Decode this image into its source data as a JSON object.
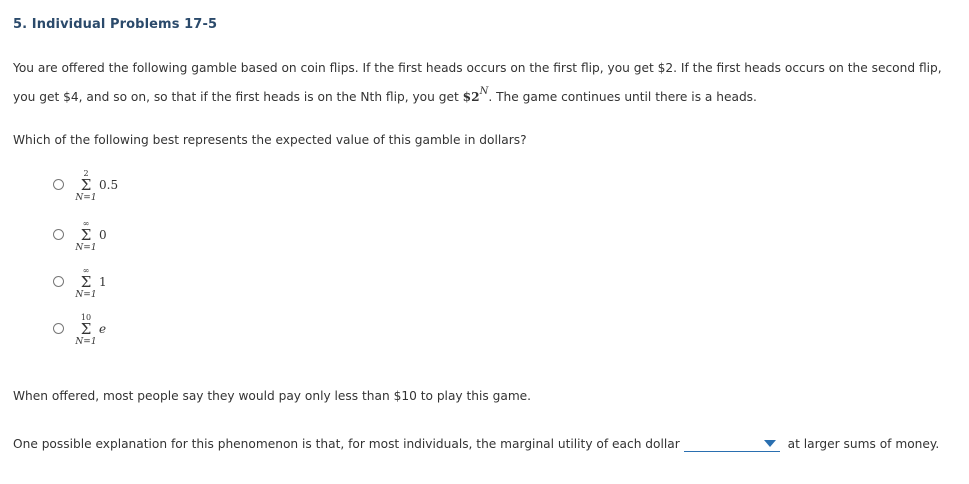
{
  "title": "5. Individual Problems 17-5",
  "intro": {
    "part1": "You are offered the following gamble based on coin flips. If the first heads occurs on the first flip, you get $2. If the first heads occurs on the second flip, you get $4, and so on, so that if the first heads is on the Nth flip, you get ",
    "payout_base": "$2",
    "payout_exp": "N",
    "part2": ". The game continues until there is a heads."
  },
  "question": "Which of the following best represents the expected value of this gamble in dollars?",
  "options": [
    {
      "upper": "2",
      "lower": "N=1",
      "term": "0.5"
    },
    {
      "upper": "∞",
      "lower": "N=1",
      "term": "0"
    },
    {
      "upper": "∞",
      "lower": "N=1",
      "term": "1"
    },
    {
      "upper": "10",
      "lower": "N=1",
      "term": "e"
    }
  ],
  "sigma_symbol": "Σ",
  "statement": "When offered, most people say they would pay only less than $10 to play this game.",
  "explanation": {
    "before": "One possible explanation for this phenomenon is that, for most individuals, the marginal utility of each dollar",
    "dropdown_value": "",
    "after": " at larger sums of money."
  },
  "colors": {
    "title": "#2b4a6b",
    "accent": "#2a6fb0",
    "text": "#333333"
  },
  "icons": {
    "dropdown": "triangle-down-icon",
    "radio": "radio-circle-icon"
  }
}
